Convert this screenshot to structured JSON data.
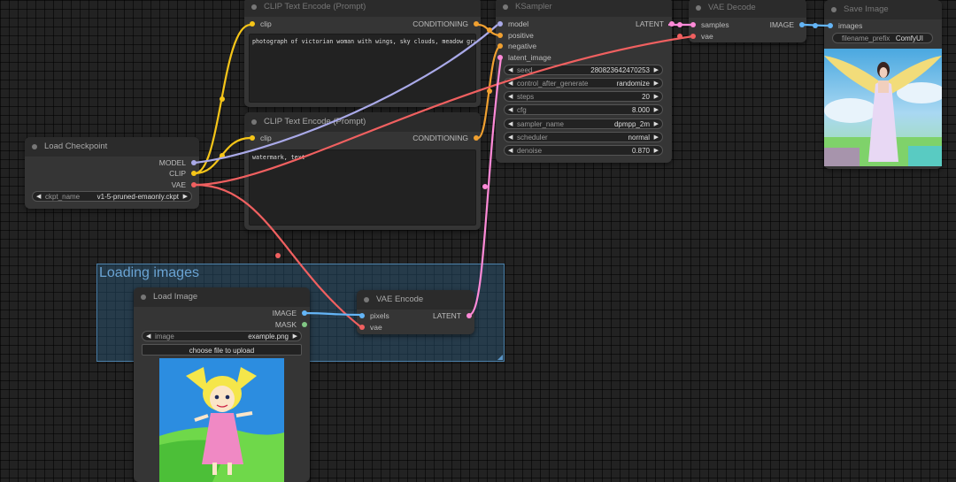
{
  "group": {
    "title": "Loading images"
  },
  "nodes": {
    "clip1": {
      "title": "CLIP Text Encode (Prompt)",
      "input": "clip",
      "output": "CONDITIONING",
      "text": "photograph of victorian woman with wings, sky clouds, meadow grass"
    },
    "clip2": {
      "title": "CLIP Text Encode (Prompt)",
      "input": "clip",
      "output": "CONDITIONING",
      "text": "watermark, text"
    },
    "checkpoint": {
      "title": "Load Checkpoint",
      "outputs": [
        "MODEL",
        "CLIP",
        "VAE"
      ],
      "widget_label": "ckpt_name",
      "widget_value": "v1-5-pruned-emaonly.ckpt"
    },
    "ksampler": {
      "title": "KSampler",
      "inputs": [
        "model",
        "positive",
        "negative",
        "latent_image"
      ],
      "output": "LATENT",
      "widgets": [
        {
          "label": "seed",
          "value": "280823642470253"
        },
        {
          "label": "control_after_generate",
          "value": "randomize"
        },
        {
          "label": "steps",
          "value": "20"
        },
        {
          "label": "cfg",
          "value": "8.000"
        },
        {
          "label": "sampler_name",
          "value": "dpmpp_2m"
        },
        {
          "label": "scheduler",
          "value": "normal"
        },
        {
          "label": "denoise",
          "value": "0.870"
        }
      ]
    },
    "vae_decode": {
      "title": "VAE Decode",
      "inputs": [
        "samples",
        "vae"
      ],
      "output": "IMAGE"
    },
    "save_image": {
      "title": "Save Image",
      "input": "images",
      "widget_label": "filename_prefix",
      "widget_value": "ComfyUI"
    },
    "load_image": {
      "title": "Load Image",
      "outputs": [
        "IMAGE",
        "MASK"
      ],
      "widget_label": "image",
      "widget_value": "example.png",
      "upload_label": "choose file to upload"
    },
    "vae_encode": {
      "title": "VAE Encode",
      "inputs": [
        "pixels",
        "vae"
      ],
      "output": "LATENT"
    }
  },
  "colors": {
    "clip": "#f5c518",
    "conditioning": "#f0a030",
    "model": "#a9a9e8",
    "vae": "#f06060",
    "latent": "#ff8ad8",
    "image": "#64b5f6",
    "mask": "#81c784",
    "group": "#2d5f82"
  }
}
